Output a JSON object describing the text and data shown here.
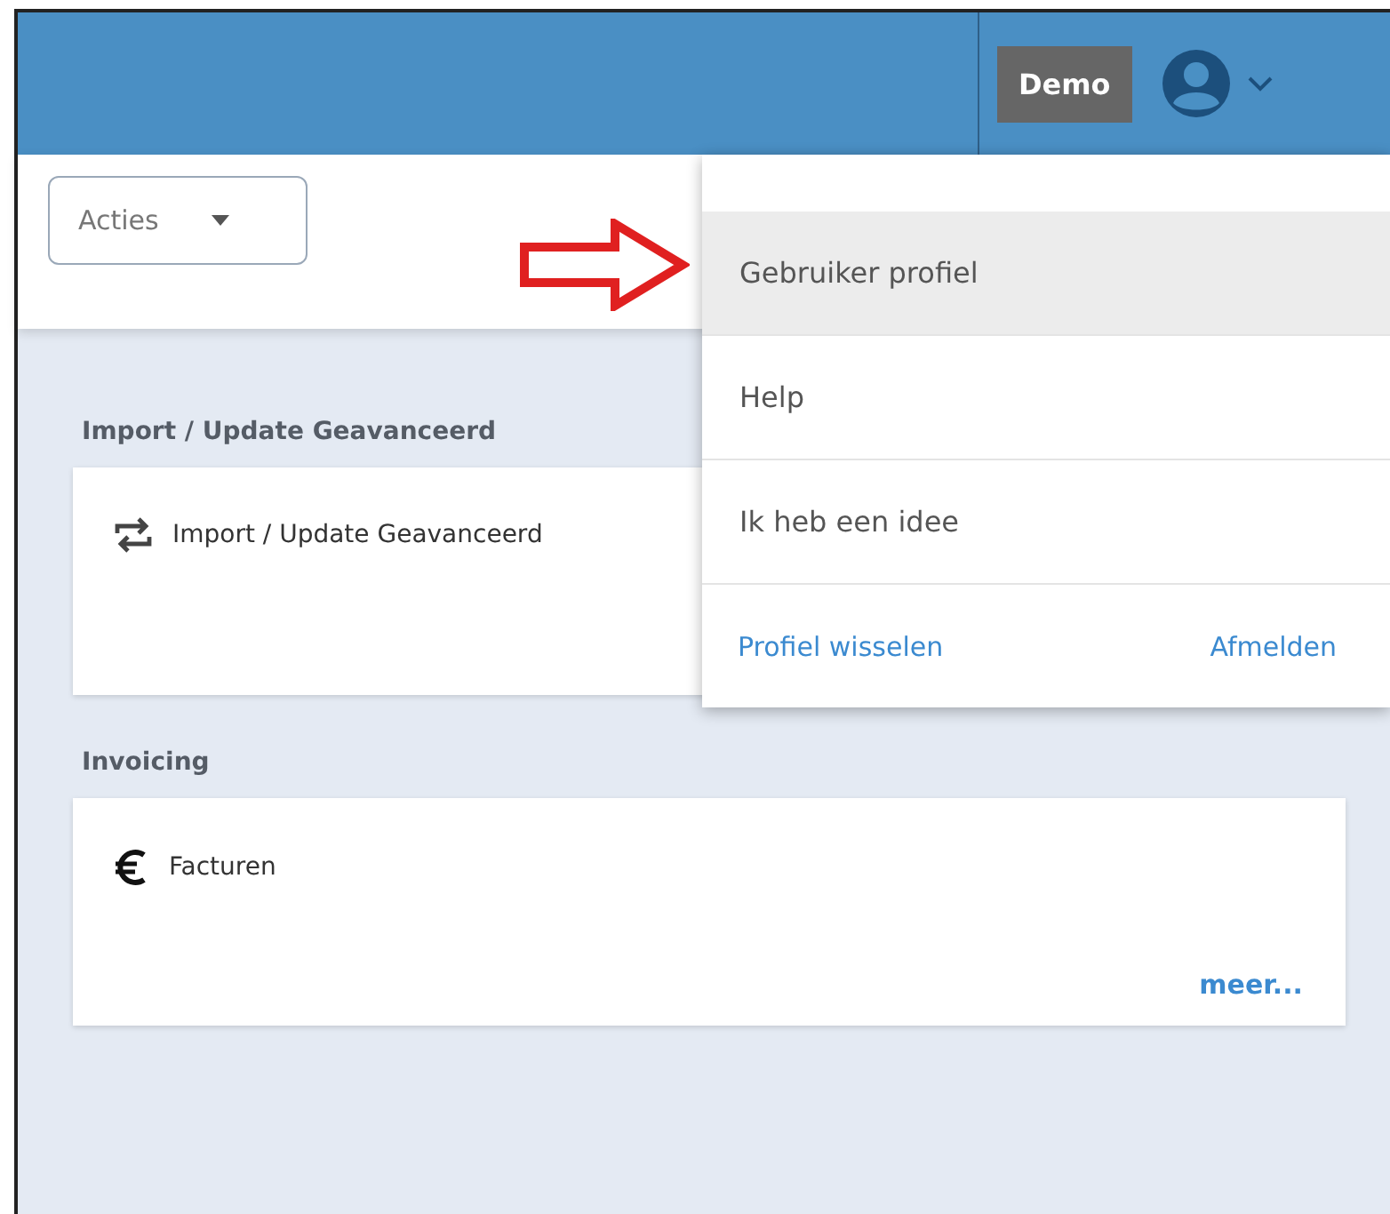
{
  "header": {
    "badge": "Demo"
  },
  "toolbar": {
    "actions_dropdown": {
      "label": "Acties"
    }
  },
  "sections": [
    {
      "title": "Import / Update Geavanceerd",
      "items": [
        {
          "kind": "swap",
          "label": "Import / Update Geavanceerd"
        }
      ]
    },
    {
      "title": "Invoicing",
      "items": [
        {
          "kind": "euro",
          "label": "Facturen"
        }
      ],
      "more_link": "meer..."
    }
  ],
  "user_menu": {
    "items": [
      {
        "label": "Gebruiker profiel",
        "selected": true
      },
      {
        "label": "Help",
        "selected": false
      },
      {
        "label": "Ik heb een idee",
        "selected": false
      }
    ],
    "footer_links": [
      "Profiel wisselen",
      "Afmelden"
    ]
  }
}
